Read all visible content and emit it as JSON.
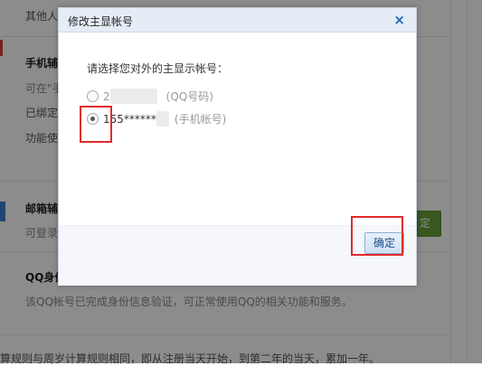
{
  "background": {
    "other_person": "其他人",
    "phone_aux_title": "手机辅",
    "phone_aux_line1": "可在\"手",
    "phone_aux_line2": "已绑定",
    "phone_aux_line3": "功能使",
    "mail_aux_title": "邮箱辅",
    "mail_aux_line1": "可登录",
    "green_button_label": "定",
    "qq_id_title": "QQ身份",
    "qq_id_desc": "该QQ帐号已完成身份信息验证，可正常使用QQ的相关功能和服务。",
    "bottom_text": "算规则与周岁计算规则相同，即从注册当天开始，到第二年的当天，累加一年。"
  },
  "dialog": {
    "title": "修改主显帐号",
    "close_symbol": "×",
    "prompt": "请选择您对外的主显示帐号：",
    "options": [
      {
        "value_visible": "2",
        "note": "(QQ号码)",
        "selected": false
      },
      {
        "value_visible": "155******",
        "note": "(手机帐号)",
        "selected": true
      }
    ],
    "confirm_label": "确定"
  },
  "colors": {
    "overlay": "#000000",
    "header_bg": "#e4ecf6",
    "highlight": "#e02b2b",
    "bg_button": "#6a9e3a"
  }
}
